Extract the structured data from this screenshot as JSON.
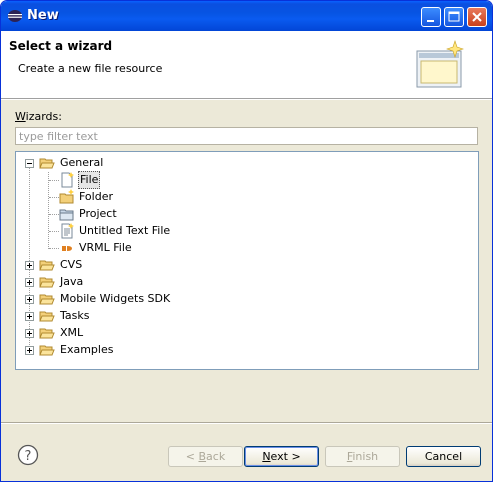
{
  "window": {
    "title": "New",
    "controls": [
      "minimize-icon",
      "maximize-icon",
      "close-icon"
    ]
  },
  "header": {
    "title": "Select a wizard",
    "description": "Create a new file resource",
    "banner_icon": "new-file-wizard-banner-icon"
  },
  "wizards": {
    "label_mnemonic": "W",
    "label_rest": "izards:",
    "filter_placeholder": "type filter text",
    "tree": [
      {
        "label": "General",
        "expanded": true,
        "icon": "folder-open-icon",
        "children": [
          {
            "label": "File",
            "icon": "new-file-icon",
            "selected": true
          },
          {
            "label": "Folder",
            "icon": "new-folder-icon"
          },
          {
            "label": "Project",
            "icon": "new-project-icon"
          },
          {
            "label": "Untitled Text File",
            "icon": "text-file-icon"
          },
          {
            "label": "VRML File",
            "icon": "vrml-file-icon"
          }
        ]
      },
      {
        "label": "CVS",
        "expanded": false,
        "icon": "folder-open-icon"
      },
      {
        "label": "Java",
        "expanded": false,
        "icon": "folder-open-icon"
      },
      {
        "label": "Mobile Widgets SDK",
        "expanded": false,
        "icon": "folder-open-icon"
      },
      {
        "label": "Tasks",
        "expanded": false,
        "icon": "folder-open-icon"
      },
      {
        "label": "XML",
        "expanded": false,
        "icon": "folder-open-icon"
      },
      {
        "label": "Examples",
        "expanded": false,
        "icon": "folder-open-icon"
      }
    ]
  },
  "buttons": {
    "help_icon": "help-icon",
    "back_prefix": "< ",
    "back_mnemonic": "B",
    "back_rest": "ack",
    "next_mnemonic": "N",
    "next_rest": "ext >",
    "finish_mnemonic": "F",
    "finish_rest": "inish",
    "cancel": "Cancel"
  }
}
